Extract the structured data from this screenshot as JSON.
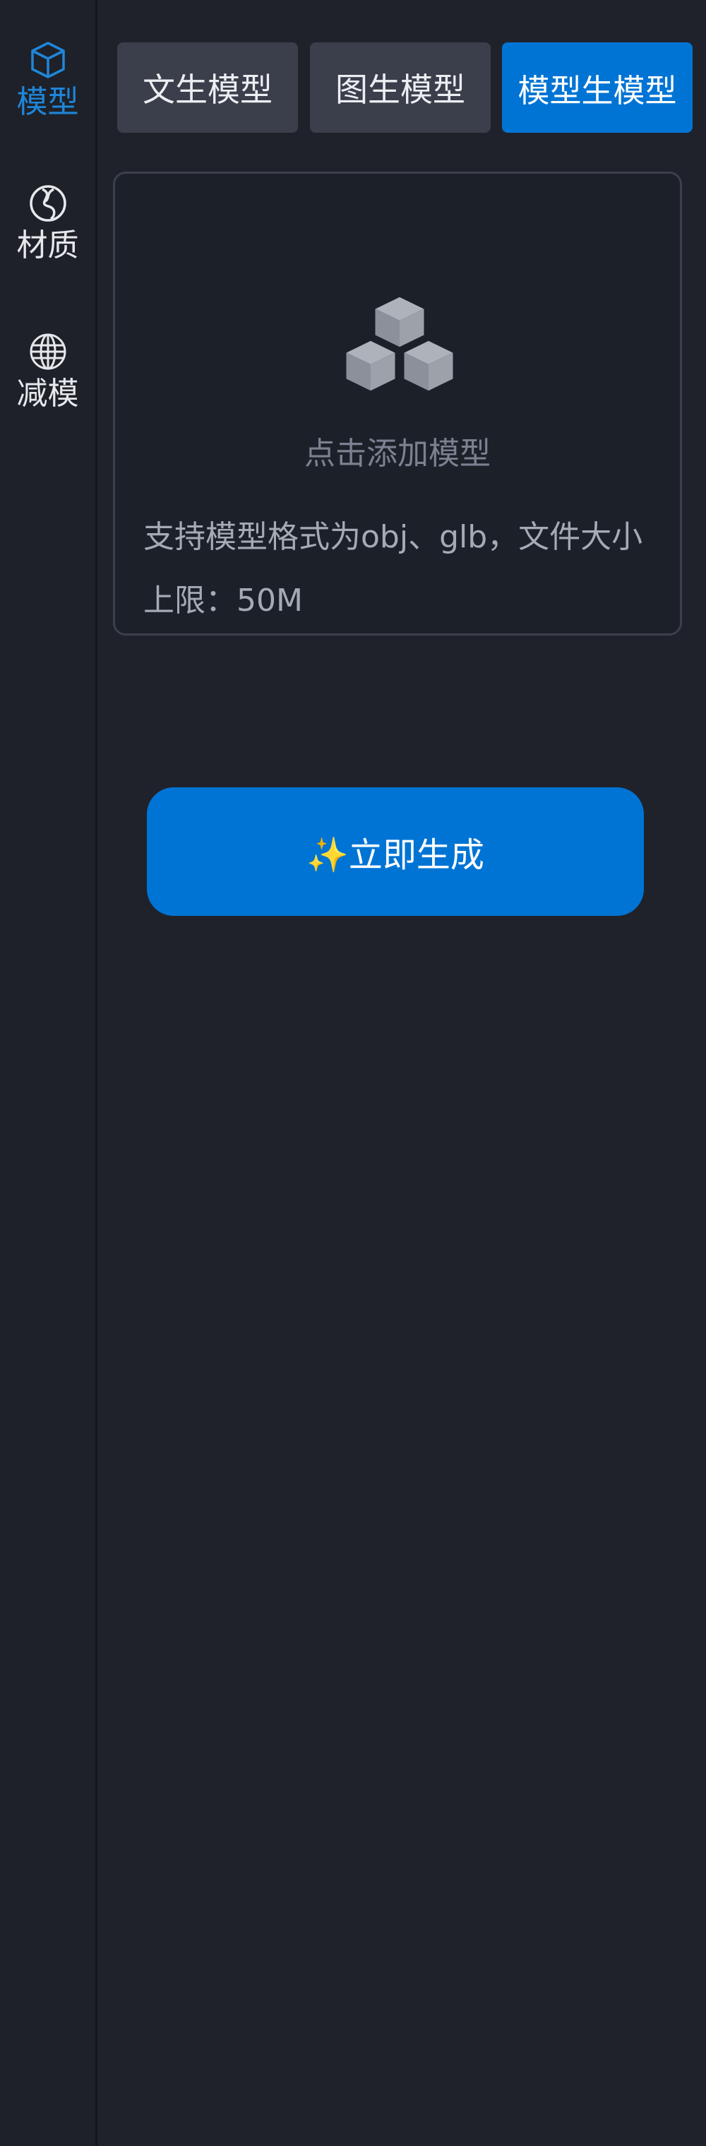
{
  "sidebar": {
    "items": [
      {
        "label": "模型",
        "icon": "cube-icon",
        "active": true
      },
      {
        "label": "材质",
        "icon": "material-sphere-icon",
        "active": false
      },
      {
        "label": "减模",
        "icon": "wireframe-globe-icon",
        "active": false
      }
    ]
  },
  "tabs": [
    {
      "label": "文生模型",
      "active": false
    },
    {
      "label": "图生模型",
      "active": false
    },
    {
      "label": "模型生模型",
      "active": true
    }
  ],
  "upload": {
    "icon": "cubes-stack-icon",
    "add_label": "点击添加模型",
    "hint": "支持模型格式为obj、glb，文件大小上限：50M"
  },
  "generate": {
    "label": "✨立即生成"
  },
  "colors": {
    "background": "#1f222b",
    "accent": "#0074d4",
    "tab_inactive": "#3a3f4b",
    "sidebar_active": "#1f86d9"
  }
}
